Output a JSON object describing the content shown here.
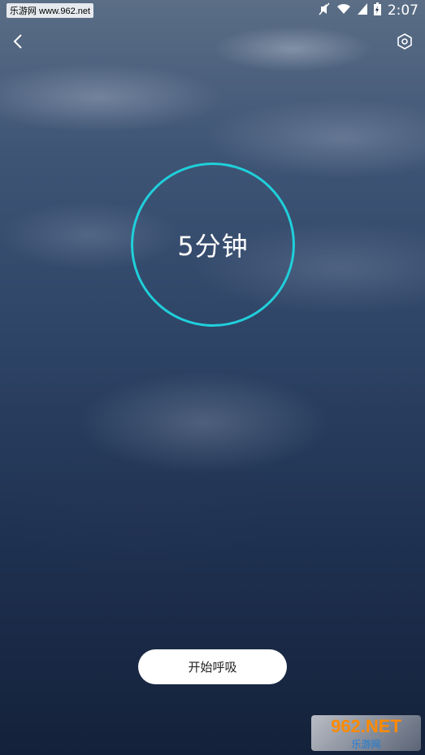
{
  "status_bar": {
    "watermark": "乐游网 www.962.net",
    "time": "2:07"
  },
  "main": {
    "duration_label": "5分钟",
    "start_button_label": "开始呼吸"
  },
  "watermark_bottom": {
    "number": "962.NET",
    "text": "乐游网"
  },
  "colors": {
    "ring": "#1fd0db",
    "button_bg": "#ffffff"
  },
  "icons": {
    "back": "chevron-left-icon",
    "settings": "hexagon-settings-icon"
  }
}
